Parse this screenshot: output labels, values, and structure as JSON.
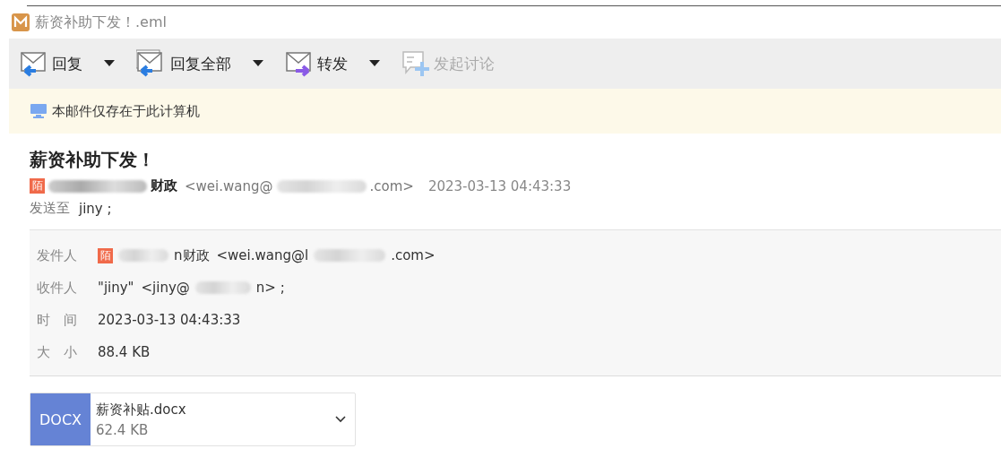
{
  "window": {
    "title": "薪资补助下发！.eml"
  },
  "toolbar": {
    "buttons": [
      {
        "label": "回复",
        "kind": "reply",
        "dropdown": true,
        "disabled": false
      },
      {
        "label": "回复全部",
        "kind": "reply_all",
        "dropdown": true,
        "disabled": false
      },
      {
        "label": "转发",
        "kind": "forward",
        "dropdown": true,
        "disabled": false
      },
      {
        "label": "发起讨论",
        "kind": "discuss",
        "dropdown": false,
        "disabled": true
      }
    ]
  },
  "notice": {
    "text": "本邮件仅存在于此计算机"
  },
  "message": {
    "subject": "薪资补助下发！",
    "sender": {
      "avatar": "陌",
      "name_tail": "财政",
      "email_head": "<wei.wang@",
      "email_tail": ".com>"
    },
    "date": "2023-03-13 04:43:33",
    "to_label": "发送至",
    "to": "jiny ;"
  },
  "details": [
    {
      "label": "发件人",
      "kind": "sender",
      "avatar": "陌",
      "name_tail": "n财政",
      "email_head": "<wei.wang@l",
      "email_tail": ".com>"
    },
    {
      "label": "收件人",
      "kind": "recipient",
      "name": "\"jiny\"",
      "email_head": "<jiny@",
      "email_tail": "n> ;"
    },
    {
      "label": "时　间",
      "kind": "text",
      "value": "2023-03-13 04:43:33"
    },
    {
      "label": "大　小",
      "kind": "text",
      "value": "88.4 KB"
    }
  ],
  "attachments": [
    {
      "type": "DOCX",
      "name": "薪资补贴.docx",
      "size": "62.4 KB"
    }
  ]
}
